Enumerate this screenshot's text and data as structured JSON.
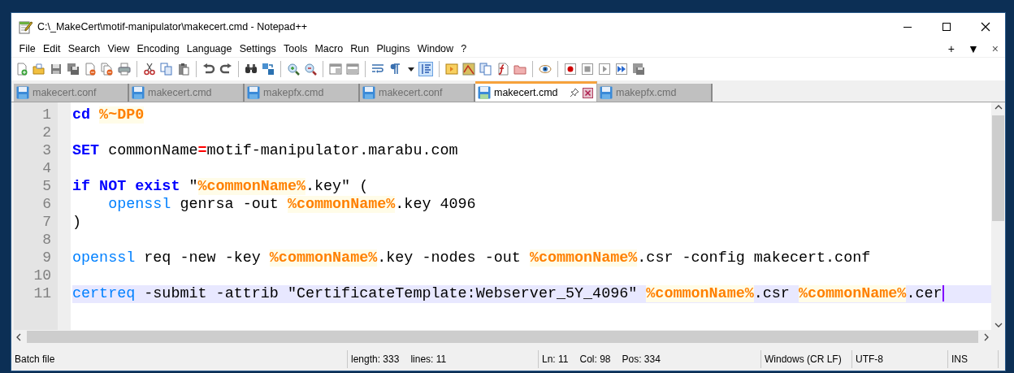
{
  "window": {
    "title": "C:\\_MakeCert\\motif-manipulator\\makecert.cmd - Notepad++"
  },
  "menu": {
    "items": [
      "File",
      "Edit",
      "Search",
      "View",
      "Encoding",
      "Language",
      "Settings",
      "Tools",
      "Macro",
      "Run",
      "Plugins",
      "Window",
      "?"
    ],
    "right": [
      "+",
      "▼",
      "×"
    ]
  },
  "tabs": [
    {
      "label": "makecert.conf",
      "selected": false
    },
    {
      "label": "makecert.cmd",
      "selected": false
    },
    {
      "label": "makepfx.cmd",
      "selected": false
    },
    {
      "label": "makecert.conf",
      "selected": false
    },
    {
      "label": "makecert.cmd",
      "selected": true
    },
    {
      "label": "makepfx.cmd",
      "selected": false
    }
  ],
  "editor": {
    "lines": [
      {
        "number": "1",
        "current": false,
        "indented": false,
        "tokens": [
          {
            "kind": "keyword",
            "text": "cd "
          },
          {
            "kind": "variable",
            "text": "%~DP0"
          }
        ]
      },
      {
        "number": "2",
        "current": false
      },
      {
        "number": "3",
        "current": false,
        "indented": false,
        "tokens": [
          {
            "kind": "keyword",
            "text": "SET"
          },
          {
            "kind": "text",
            "text": " commonName"
          },
          {
            "kind": "operator",
            "text": "="
          },
          {
            "kind": "text",
            "text": "motif-manipulator.marabu.com"
          }
        ]
      },
      {
        "number": "4",
        "current": false
      },
      {
        "number": "5",
        "current": false,
        "indented": false,
        "tokens": [
          {
            "kind": "keyword",
            "text": "if NOT exist"
          },
          {
            "kind": "text",
            "text": " \""
          },
          {
            "kind": "variable",
            "text": "%commonName%"
          },
          {
            "kind": "text",
            "text": ".key\" ("
          }
        ]
      },
      {
        "number": "6",
        "current": false,
        "indented": true,
        "tokens": [
          {
            "kind": "command",
            "text": "openssl"
          },
          {
            "kind": "text",
            "text": " genrsa -out "
          },
          {
            "kind": "variable",
            "text": "%commonName%"
          },
          {
            "kind": "text",
            "text": ".key 4096"
          }
        ]
      },
      {
        "number": "7",
        "current": false,
        "indented": false,
        "tokens": [
          {
            "kind": "text",
            "text": ")"
          }
        ]
      },
      {
        "number": "8",
        "current": false
      },
      {
        "number": "9",
        "current": false,
        "indented": false,
        "tokens": [
          {
            "kind": "command",
            "text": "openssl"
          },
          {
            "kind": "text",
            "text": " req -new -key "
          },
          {
            "kind": "variable",
            "text": "%commonName%"
          },
          {
            "kind": "text",
            "text": ".key -nodes -out "
          },
          {
            "kind": "variable",
            "text": "%commonName%"
          },
          {
            "kind": "text",
            "text": ".csr -config makecert.conf"
          }
        ]
      },
      {
        "number": "10",
        "current": false
      },
      {
        "number": "11",
        "current": true,
        "indented": false,
        "tokens": [
          {
            "kind": "command",
            "text": "certreq"
          },
          {
            "kind": "text",
            "text": " -submit -attrib \"CertificateTemplate:Webserver_5Y_4096\" "
          },
          {
            "kind": "variable",
            "text": "%commonName%"
          },
          {
            "kind": "text",
            "text": ".csr "
          },
          {
            "kind": "variable",
            "text": "%commonName%"
          },
          {
            "kind": "text",
            "text": ".cer"
          }
        ]
      }
    ]
  },
  "status_bar": {
    "language": "Batch file",
    "length": "length: 333",
    "lines": "lines: 11",
    "line": "Ln: 11",
    "column": "Col: 98",
    "position": "Pos: 334",
    "line_endings": "Windows (CR LF)",
    "encoding": "UTF-8",
    "mode": "INS"
  }
}
